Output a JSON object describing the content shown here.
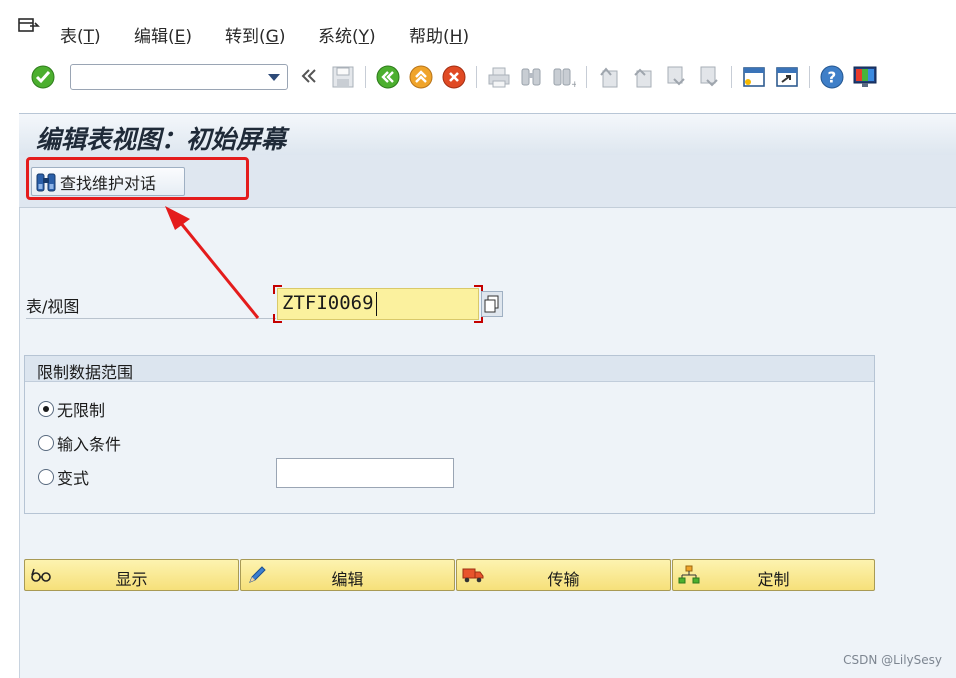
{
  "menubar": {
    "items": [
      {
        "label": "表(",
        "key": "T",
        "suffix": ")"
      },
      {
        "label": "编辑(",
        "key": "E",
        "suffix": ")"
      },
      {
        "label": "转到(",
        "key": "G",
        "suffix": ")"
      },
      {
        "label": "系统(",
        "key": "Y",
        "suffix": ")"
      },
      {
        "label": "帮助(",
        "key": "H",
        "suffix": ")"
      }
    ]
  },
  "toolbar": {
    "command_field_value": "",
    "icons": [
      "enter-check-icon",
      "history-chevron-icon",
      "save-icon",
      "back-icon",
      "exit-icon",
      "cancel-icon",
      "print-icon",
      "find-icon",
      "find-next-icon",
      "first-page-icon",
      "previous-page-icon",
      "next-page-icon",
      "last-page-icon",
      "new-session-icon",
      "shortcut-icon",
      "help-icon",
      "layout-icon"
    ]
  },
  "page": {
    "title": "编辑表视图：初始屏幕",
    "find_button_label": "查找维护对话"
  },
  "table_field": {
    "label": "表/视图",
    "value": "ZTFI0069"
  },
  "restriction_group": {
    "title": "限制数据范围",
    "options": [
      {
        "label": "无限制",
        "selected": true
      },
      {
        "label": "输入条件",
        "selected": false
      },
      {
        "label": "变式",
        "selected": false
      }
    ],
    "variant_value": ""
  },
  "actions": [
    {
      "label": "显示",
      "icon": "glasses-icon"
    },
    {
      "label": "编辑",
      "icon": "pencil-icon"
    },
    {
      "label": "传输",
      "icon": "truck-icon"
    },
    {
      "label": "定制",
      "icon": "hierarchy-icon"
    }
  ],
  "watermark": "CSDN @LilySesy",
  "colors": {
    "highlight_red": "#e41c1c",
    "required_field_yellow": "#fbf19e",
    "action_button_yellow": "#f6e07a",
    "background_blue": "#eef3f8"
  }
}
